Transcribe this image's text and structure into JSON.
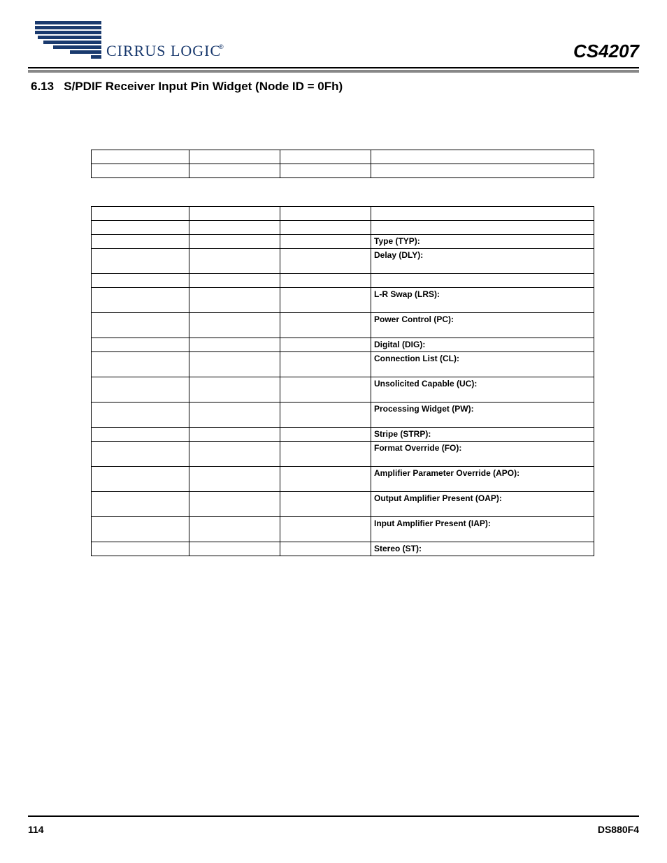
{
  "header": {
    "brand_word": "CIRRUS LOGIC",
    "part_number": "CS4207"
  },
  "section": {
    "number": "6.13",
    "title": "S/PDIF Receiver Input Pin Widget (Node ID = 0Fh)"
  },
  "table1": {
    "rows": [
      [
        "",
        "",
        "",
        ""
      ],
      [
        "",
        "",
        "",
        ""
      ]
    ]
  },
  "table2": {
    "rows": [
      {
        "h": "short",
        "cells": [
          "",
          "",
          "",
          ""
        ]
      },
      {
        "h": "short",
        "cells": [
          "",
          "",
          "",
          ""
        ]
      },
      {
        "h": "short",
        "cells": [
          "",
          "",
          "",
          "Type (TYP):"
        ]
      },
      {
        "h": "tall",
        "cells": [
          "",
          "",
          "",
          "Delay (DLY):"
        ]
      },
      {
        "h": "short",
        "cells": [
          "",
          "",
          "",
          ""
        ]
      },
      {
        "h": "tall",
        "cells": [
          "",
          "",
          "",
          "L-R Swap (LRS):"
        ]
      },
      {
        "h": "tall",
        "cells": [
          "",
          "",
          "",
          "Power Control (PC):"
        ]
      },
      {
        "h": "short",
        "cells": [
          "",
          "",
          "",
          "Digital (DIG):"
        ]
      },
      {
        "h": "tall",
        "cells": [
          "",
          "",
          "",
          "Connection List (CL):"
        ]
      },
      {
        "h": "tall",
        "cells": [
          "",
          "",
          "",
          "Unsolicited Capable (UC):"
        ]
      },
      {
        "h": "tall",
        "cells": [
          "",
          "",
          "",
          "Processing Widget (PW):"
        ]
      },
      {
        "h": "short",
        "cells": [
          "",
          "",
          "",
          "Stripe (STRP):"
        ]
      },
      {
        "h": "tall",
        "cells": [
          "",
          "",
          "",
          "Format Override (FO):"
        ]
      },
      {
        "h": "tall",
        "cells": [
          "",
          "",
          "",
          "Amplifier Parameter Override (APO):"
        ]
      },
      {
        "h": "tall",
        "cells": [
          "",
          "",
          "",
          "Output Amplifier Present (OAP):"
        ]
      },
      {
        "h": "tall",
        "cells": [
          "",
          "",
          "",
          "Input Amplifier Present (IAP):"
        ]
      },
      {
        "h": "short",
        "cells": [
          "",
          "",
          "",
          "Stereo (ST):"
        ]
      }
    ]
  },
  "footer": {
    "page": "114",
    "doc": "DS880F4"
  }
}
